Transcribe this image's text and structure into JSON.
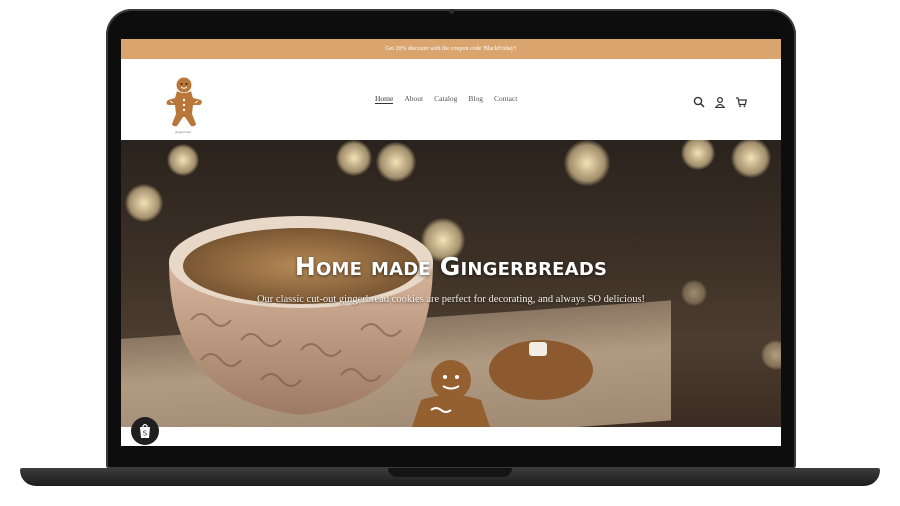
{
  "announcement": {
    "text": "Get 20% discount with the coupon code 'BlackFriday'!"
  },
  "header": {
    "logo_caption": "gingerbread",
    "nav": [
      {
        "label": "Home",
        "active": true
      },
      {
        "label": "About",
        "active": false
      },
      {
        "label": "Catalog",
        "active": false
      },
      {
        "label": "Blog",
        "active": false
      },
      {
        "label": "Contact",
        "active": false
      }
    ],
    "icons": [
      "search-icon",
      "account-icon",
      "cart-icon"
    ]
  },
  "hero": {
    "title": "Home made Gingerbreads",
    "subtitle": "Our classic cut-out gingerbread cookies are perfect for decorating, and always SO delicious!"
  },
  "badge": {
    "icon": "shopify-bag-icon"
  },
  "colors": {
    "announce_bg": "#d9a46e",
    "frame": "#0d0d0d",
    "text_dark": "#333333"
  }
}
